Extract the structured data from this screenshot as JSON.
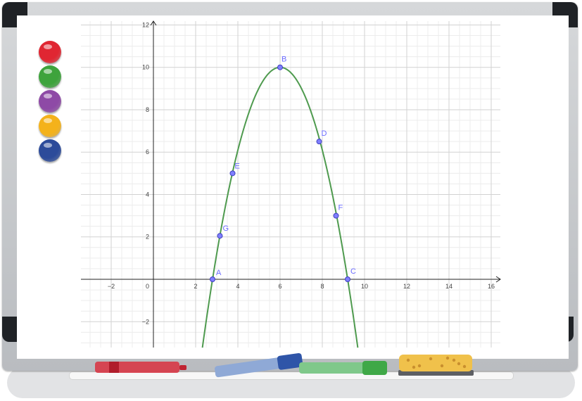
{
  "magnets": [
    {
      "name": "red-magnet",
      "color": "#e02632"
    },
    {
      "name": "green-magnet",
      "color": "#3ea33c"
    },
    {
      "name": "purple-magnet",
      "color": "#8e4aa6"
    },
    {
      "name": "yellow-magnet",
      "color": "#f4b21b"
    },
    {
      "name": "blue-magnet",
      "color": "#2c4b9a"
    }
  ],
  "tray_items": [
    {
      "name": "red-marker",
      "color": "#d9303e"
    },
    {
      "name": "blue-marker",
      "color": "#2f55a8"
    },
    {
      "name": "green-marker",
      "color": "#3fa847"
    },
    {
      "name": "sponge-eraser",
      "color": "#f0c14b"
    }
  ],
  "colors": {
    "curve": "#4e9a4e",
    "point_fill": "#7f7fff",
    "point_stroke": "#3f3fbf",
    "label": "#6b6bff",
    "grid_major": "#d2d2d2",
    "grid_minor": "#ececec",
    "axis": "#222222"
  },
  "chart_data": {
    "type": "line",
    "title": "",
    "xlabel": "",
    "ylabel": "",
    "grid": true,
    "xlim": [
      -3.5,
      16.5
    ],
    "ylim": [
      -3.3,
      12.2
    ],
    "x_ticks": [
      -2,
      2,
      4,
      6,
      8,
      10,
      12,
      14,
      16
    ],
    "y_ticks": [
      -2,
      2,
      4,
      6,
      8,
      10,
      12
    ],
    "origin_label": "0",
    "curve": {
      "expression": "y = -10/10.24 (x - 6)^2 + 10",
      "vertex": [
        6,
        10
      ],
      "roots": [
        2.8,
        9.2
      ]
    },
    "points": [
      {
        "label": "A",
        "x": 2.8,
        "y": 0
      },
      {
        "label": "B",
        "x": 6.0,
        "y": 10
      },
      {
        "label": "C",
        "x": 9.2,
        "y": 0
      },
      {
        "label": "D",
        "x": 7.85,
        "y": 6.5
      },
      {
        "label": "E",
        "x": 3.75,
        "y": 5.0
      },
      {
        "label": "F",
        "x": 8.65,
        "y": 3.0
      },
      {
        "label": "G",
        "x": 3.15,
        "y": 2.05
      }
    ]
  }
}
